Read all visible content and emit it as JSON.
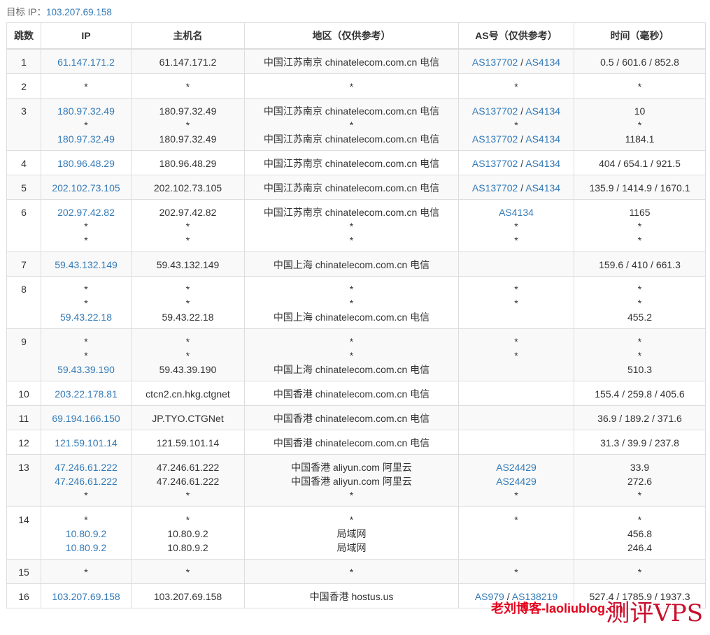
{
  "target": {
    "label": "目标 IP：",
    "ip": "103.207.69.158"
  },
  "table": {
    "headers": [
      "跳数",
      "IP",
      "主机名",
      "地区（仅供参考）",
      "AS号（仅供参考）",
      "时间（毫秒）"
    ],
    "rows": [
      {
        "hop": "1",
        "lines": [
          {
            "ip": "61.147.171.2",
            "host": "61.147.171.2",
            "region": "中国江苏南京 chinatelecom.com.cn 电信",
            "as": [
              "AS137702",
              "AS4134"
            ]
          }
        ],
        "time": [
          "0.5 / 601.6 / 852.8"
        ]
      },
      {
        "hop": "2",
        "lines": [
          {
            "ip": "*",
            "host": "*",
            "region": "*",
            "as": [
              "*"
            ]
          }
        ],
        "time": [
          "*"
        ]
      },
      {
        "hop": "3",
        "lines": [
          {
            "ip": "180.97.32.49",
            "host": "180.97.32.49",
            "region": "中国江苏南京 chinatelecom.com.cn 电信",
            "as": [
              "AS137702",
              "AS4134"
            ]
          },
          {
            "ip": "*",
            "host": "*",
            "region": "*",
            "as": [
              "*"
            ]
          },
          {
            "ip": "180.97.32.49",
            "host": "180.97.32.49",
            "region": "中国江苏南京 chinatelecom.com.cn 电信",
            "as": [
              "AS137702",
              "AS4134"
            ]
          }
        ],
        "time": [
          "10",
          "*",
          "1184.1"
        ]
      },
      {
        "hop": "4",
        "lines": [
          {
            "ip": "180.96.48.29",
            "host": "180.96.48.29",
            "region": "中国江苏南京 chinatelecom.com.cn 电信",
            "as": [
              "AS137702",
              "AS4134"
            ]
          }
        ],
        "time": [
          "404 / 654.1 / 921.5"
        ]
      },
      {
        "hop": "5",
        "lines": [
          {
            "ip": "202.102.73.105",
            "host": "202.102.73.105",
            "region": "中国江苏南京 chinatelecom.com.cn 电信",
            "as": [
              "AS137702",
              "AS4134"
            ]
          }
        ],
        "time": [
          "135.9 / 1414.9 / 1670.1"
        ]
      },
      {
        "hop": "6",
        "lines": [
          {
            "ip": "202.97.42.82",
            "host": "202.97.42.82",
            "region": "中国江苏南京 chinatelecom.com.cn 电信",
            "as": [
              "AS4134"
            ]
          },
          {
            "ip": "*",
            "host": "*",
            "region": "*",
            "as": [
              "*"
            ]
          },
          {
            "ip": "*",
            "host": "*",
            "region": "*",
            "as": [
              "*"
            ]
          }
        ],
        "time": [
          "1165",
          "*",
          "*"
        ]
      },
      {
        "hop": "7",
        "lines": [
          {
            "ip": "59.43.132.149",
            "host": "59.43.132.149",
            "region": "中国上海 chinatelecom.com.cn 电信",
            "as": []
          }
        ],
        "time": [
          "159.6 / 410 / 661.3"
        ]
      },
      {
        "hop": "8",
        "lines": [
          {
            "ip": "*",
            "host": "*",
            "region": "*",
            "as": [
              "*"
            ]
          },
          {
            "ip": "*",
            "host": "*",
            "region": "*",
            "as": [
              "*"
            ]
          },
          {
            "ip": "59.43.22.18",
            "host": "59.43.22.18",
            "region": "中国上海 chinatelecom.com.cn 电信",
            "as": []
          }
        ],
        "time": [
          "*",
          "*",
          "455.2"
        ]
      },
      {
        "hop": "9",
        "lines": [
          {
            "ip": "*",
            "host": "*",
            "region": "*",
            "as": [
              "*"
            ]
          },
          {
            "ip": "*",
            "host": "*",
            "region": "*",
            "as": [
              "*"
            ]
          },
          {
            "ip": "59.43.39.190",
            "host": "59.43.39.190",
            "region": "中国上海 chinatelecom.com.cn 电信",
            "as": []
          }
        ],
        "time": [
          "*",
          "*",
          "510.3"
        ]
      },
      {
        "hop": "10",
        "lines": [
          {
            "ip": "203.22.178.81",
            "host": "ctcn2.cn.hkg.ctgnet",
            "region": "中国香港 chinatelecom.com.cn 电信",
            "as": []
          }
        ],
        "time": [
          "155.4 / 259.8 / 405.6"
        ]
      },
      {
        "hop": "11",
        "lines": [
          {
            "ip": "69.194.166.150",
            "host": "JP.TYO.CTGNet",
            "region": "中国香港 chinatelecom.com.cn 电信",
            "as": []
          }
        ],
        "time": [
          "36.9 / 189.2 / 371.6"
        ]
      },
      {
        "hop": "12",
        "lines": [
          {
            "ip": "121.59.101.14",
            "host": "121.59.101.14",
            "region": "中国香港 chinatelecom.com.cn 电信",
            "as": []
          }
        ],
        "time": [
          "31.3 / 39.9 / 237.8"
        ]
      },
      {
        "hop": "13",
        "lines": [
          {
            "ip": "47.246.61.222",
            "host": "47.246.61.222",
            "region": "中国香港 aliyun.com 阿里云",
            "as": [
              "AS24429"
            ]
          },
          {
            "ip": "47.246.61.222",
            "host": "47.246.61.222",
            "region": "中国香港 aliyun.com 阿里云",
            "as": [
              "AS24429"
            ]
          },
          {
            "ip": "*",
            "host": "*",
            "region": "*",
            "as": [
              "*"
            ]
          }
        ],
        "time": [
          "33.9",
          "272.6",
          "*"
        ]
      },
      {
        "hop": "14",
        "lines": [
          {
            "ip": "*",
            "host": "*",
            "region": "*",
            "as": [
              "*"
            ]
          },
          {
            "ip": "10.80.9.2",
            "host": "10.80.9.2",
            "region": "局域网",
            "as": []
          },
          {
            "ip": "10.80.9.2",
            "host": "10.80.9.2",
            "region": "局域网",
            "as": []
          }
        ],
        "time": [
          "*",
          "456.8",
          "246.4"
        ]
      },
      {
        "hop": "15",
        "lines": [
          {
            "ip": "*",
            "host": "*",
            "region": "*",
            "as": [
              "*"
            ]
          }
        ],
        "time": [
          "*"
        ]
      },
      {
        "hop": "16",
        "lines": [
          {
            "ip": "103.207.69.158",
            "host": "103.207.69.158",
            "region": "中国香港 hostus.us",
            "as": [
              "AS979",
              "AS138219"
            ]
          }
        ],
        "time": [
          "527.4 / 1785.9 / 1937.3"
        ]
      }
    ]
  },
  "watermark": {
    "left": "老刘博客-laoliublog.cn",
    "right": "测评VPS"
  },
  "colors": {
    "link": "#337ab7",
    "stripe": "#f9f9f9",
    "border": "#dddddd",
    "watermark": "#e3001b"
  }
}
